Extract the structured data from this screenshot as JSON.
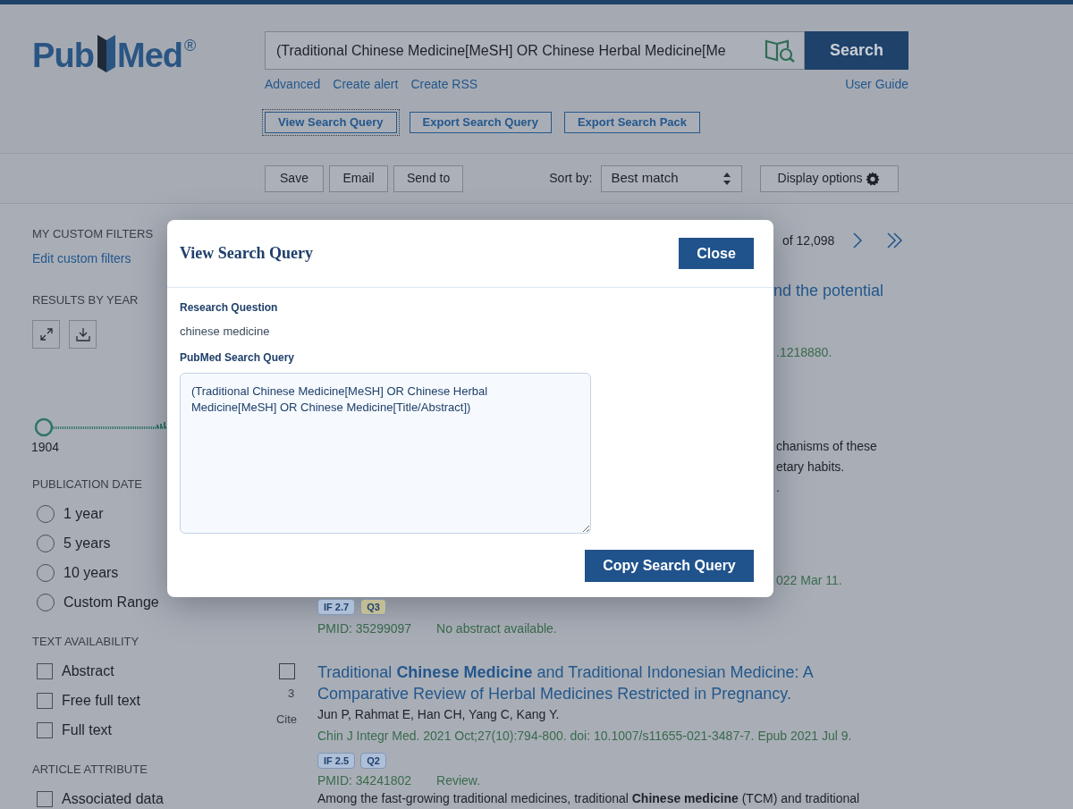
{
  "header": {
    "logo_left": "Pub",
    "logo_right": "Med",
    "registered": "®",
    "search_value": "(Traditional Chinese Medicine[MeSH] OR Chinese Herbal Medicine[Me",
    "search_button": "Search",
    "links": [
      "Advanced",
      "Create alert",
      "Create RSS"
    ],
    "user_guide": "User Guide",
    "query_buttons": [
      {
        "label": "View Search Query",
        "focused": true
      },
      {
        "label": "Export Search Query",
        "focused": false
      },
      {
        "label": "Export Search Pack",
        "focused": false
      }
    ]
  },
  "toolbar": {
    "actions": [
      "Save",
      "Email",
      "Send to"
    ],
    "sort_label": "Sort by:",
    "sort_value": "Best match",
    "display_options": "Display options"
  },
  "sidebar": {
    "custom_filters_heading": "MY CUSTOM FILTERS",
    "edit_link": "Edit custom filters",
    "results_by_year_heading": "RESULTS BY YEAR",
    "start_year": "1904",
    "publication_date_heading": "PUBLICATION DATE",
    "publication_date": [
      {
        "label": "1 year",
        "checked": false
      },
      {
        "label": "5 years",
        "checked": false
      },
      {
        "label": "10 years",
        "checked": false
      },
      {
        "label": "Custom Range",
        "checked": false
      }
    ],
    "text_availability_heading": "TEXT AVAILABILITY",
    "text_availability": [
      {
        "label": "Abstract",
        "checked": false
      },
      {
        "label": "Free full text",
        "checked": false
      },
      {
        "label": "Full text",
        "checked": false
      }
    ],
    "article_attribute_heading": "ARTICLE ATTRIBUTE",
    "article_attribute": [
      {
        "label": "Associated data",
        "checked": false
      }
    ]
  },
  "results": {
    "page_count": "of 12,098",
    "title_fragment": "nd the potential",
    "citation_fragment": ".1218880.",
    "abstract_fragments": [
      "chanisms of these",
      "etary habits.",
      "."
    ],
    "date_fragment": "022 Mar 11.",
    "article_2": {
      "badges": [
        {
          "label": "IF 2.7",
          "color": "#aebfd8"
        },
        {
          "label": "Q3",
          "color": "#c2bd94"
        }
      ],
      "pmid": "PMID: 35299097",
      "note": "No abstract available."
    },
    "article_3": {
      "checked": false,
      "number": "3",
      "cite": "Cite",
      "title": "Traditional **Chinese Medicine** and Traditional Indonesian Medicine: A Comparative Review of Herbal Medicines Restricted in Pregnancy.",
      "authors": "Jun P, Rahmat E, Han CH, Yang C, Kang Y.",
      "citation": "Chin J Integr Med. 2021 Oct;27(10):794-800. doi: 10.1007/s11655-021-3487-7. Epub 2021 Jul 9.",
      "badges": [
        {
          "label": "IF 2.5",
          "color": "#aebfd8"
        },
        {
          "label": "Q2",
          "color": "#aebfd8"
        }
      ],
      "pmid": "PMID: 34241802",
      "note": "Review.",
      "snippet": "Among the fast-growing traditional medicines, traditional **Chinese medicine** (TCM) and traditional"
    }
  },
  "modal": {
    "title": "View Search Query",
    "close": "Close",
    "question_label": "Research Question",
    "question": "chinese medicine",
    "query_label": "PubMed Search Query",
    "query": "(Traditional Chinese Medicine[MeSH] OR Chinese Herbal Medicine[MeSH] OR Chinese Medicine[Title/Abstract])",
    "copy_button": "Copy Search Query"
  }
}
